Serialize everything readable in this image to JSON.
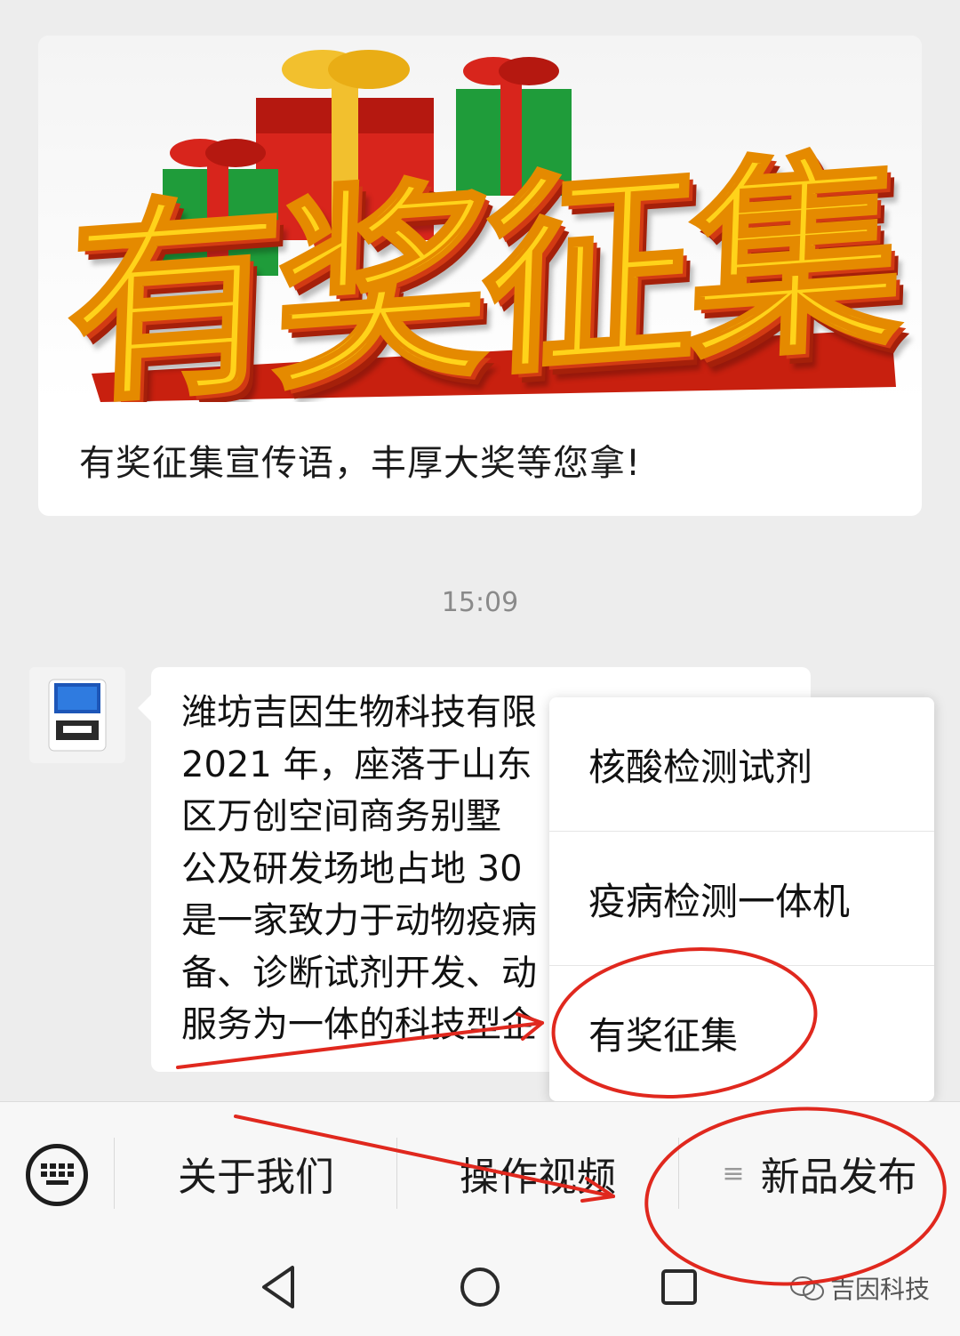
{
  "article_card": {
    "banner_text": "有奖征集",
    "caption": "有奖征集宣传语，丰厚大奖等您拿!"
  },
  "timestamp": "15:09",
  "message": {
    "avatar": "product-device-avatar",
    "lines": [
      "潍坊吉因生物科技有限",
      "2021 年，座落于山东",
      "区万创空间商务别墅",
      "公及研发场地占地 30",
      "是一家致力于动物疫病",
      "备、诊断试剂开发、动",
      "服务为一体的科技型企"
    ]
  },
  "popup_menu": {
    "items": [
      "核酸检测试剂",
      "疫病检测一体机",
      "有奖征集"
    ]
  },
  "menu_bar": {
    "keyboard_icon": "keyboard-icon",
    "items": [
      "关于我们",
      "操作视频",
      "新品发布"
    ],
    "submenu_icon": "≡"
  },
  "nav_bar": {
    "icons": [
      "back-icon",
      "home-icon",
      "recents-icon"
    ]
  },
  "watermark": {
    "text": "吉因科技",
    "icon": "wechat-icon"
  },
  "colors": {
    "annotation_red": "#e0281e",
    "background": "#ededed",
    "banner_gold": "#ffd31a",
    "banner_red": "#d23a13"
  }
}
